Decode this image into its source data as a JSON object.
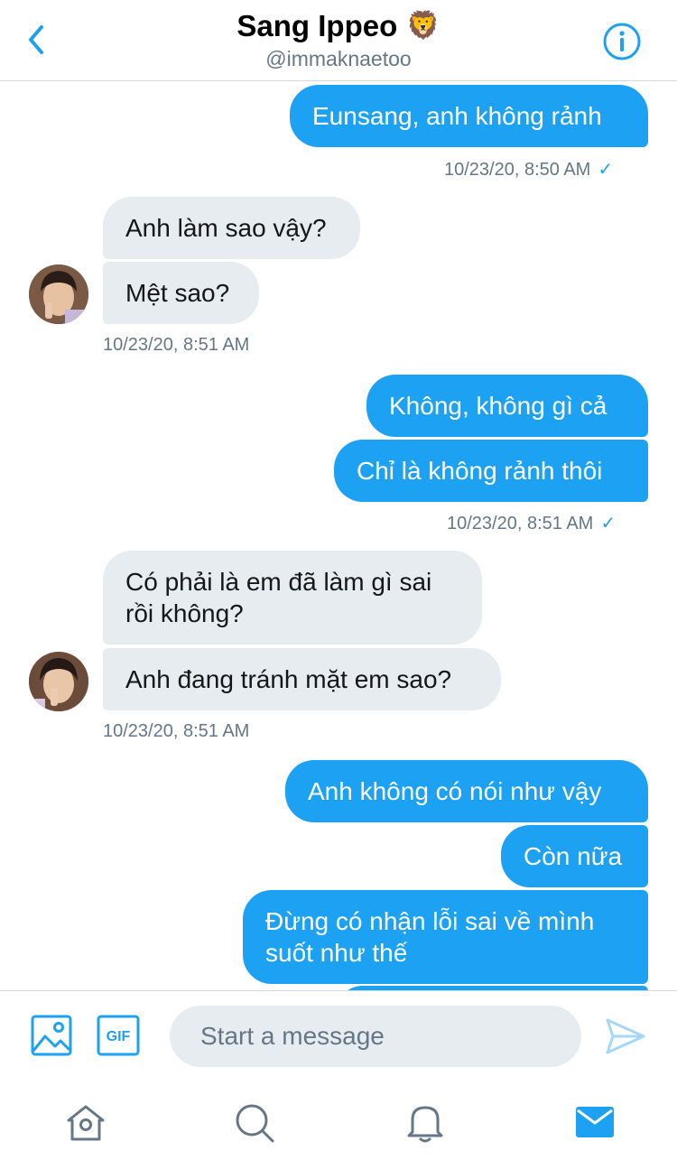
{
  "header": {
    "name": "Sang Ippeo",
    "emoji": "🦁",
    "handle": "@immaknaetoo"
  },
  "messages": [
    {
      "text": "Eunsang, anh không rảnh"
    },
    {
      "stamp": "10/23/20, 8:50 AM",
      "check": "✓"
    },
    {
      "text": "Anh làm sao vậy?"
    },
    {
      "text": "Mệt sao?"
    },
    {
      "stamp": "10/23/20, 8:51 AM"
    },
    {
      "text": "Không, không gì cả"
    },
    {
      "text": "Chỉ là không rảnh thôi"
    },
    {
      "stamp": "10/23/20, 8:51 AM",
      "check": "✓"
    },
    {
      "text": "Có phải là em đã làm gì sai rồi không?"
    },
    {
      "text": "Anh đang tránh mặt em sao?"
    },
    {
      "stamp": "10/23/20, 8:51 AM"
    },
    {
      "text": "Anh không có nói như vậy"
    },
    {
      "text": "Còn nữa"
    },
    {
      "text": "Đừng có nhận lỗi sai về mình suốt như thế"
    }
  ],
  "composer": {
    "placeholder": "Start a message",
    "gif_label": "GIF"
  },
  "icons": {
    "back": "chevron-left-icon",
    "info": "info-icon",
    "image": "image-icon",
    "gif": "gif-icon",
    "send": "send-icon",
    "home": "home-icon",
    "search": "search-icon",
    "notifications": "bell-icon",
    "messages": "mail-icon"
  },
  "colors": {
    "accent": "#1da1f2",
    "incoming_bubble": "#e6ecf0",
    "muted_text": "#657786"
  }
}
